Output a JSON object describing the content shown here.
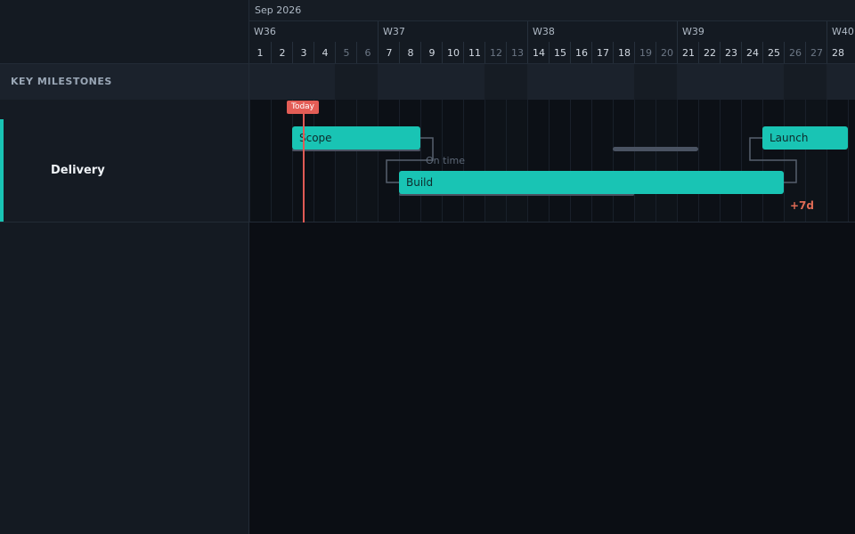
{
  "sidebar": {
    "section_title": "KEY MILESTONES",
    "group": {
      "name": "Delivery",
      "accent_color": "#19c4b4"
    }
  },
  "timeline": {
    "month": "Sep 2026",
    "weeks": [
      "W36",
      "W37",
      "W38",
      "W39",
      "W40"
    ],
    "days": [
      "1",
      "2",
      "3",
      "4",
      "5",
      "6",
      "7",
      "8",
      "9",
      "10",
      "11",
      "12",
      "13",
      "14",
      "15",
      "16",
      "17",
      "18",
      "19",
      "20",
      "21",
      "22",
      "23",
      "24",
      "25",
      "26",
      "27",
      "28"
    ],
    "weekend_days": [
      "5",
      "6",
      "12",
      "13",
      "19",
      "20",
      "26",
      "27"
    ]
  },
  "today": {
    "label": "Today",
    "color": "#e35d56"
  },
  "tasks": [
    {
      "name": "Scope",
      "color": "#19c4b4"
    },
    {
      "name": "Build",
      "color": "#19c4b4"
    },
    {
      "name": "Launch",
      "color": "#19c4b4"
    }
  ],
  "annotations": {
    "on_time": "On time",
    "delay": "+7d",
    "delay_color": "#e06b55"
  }
}
